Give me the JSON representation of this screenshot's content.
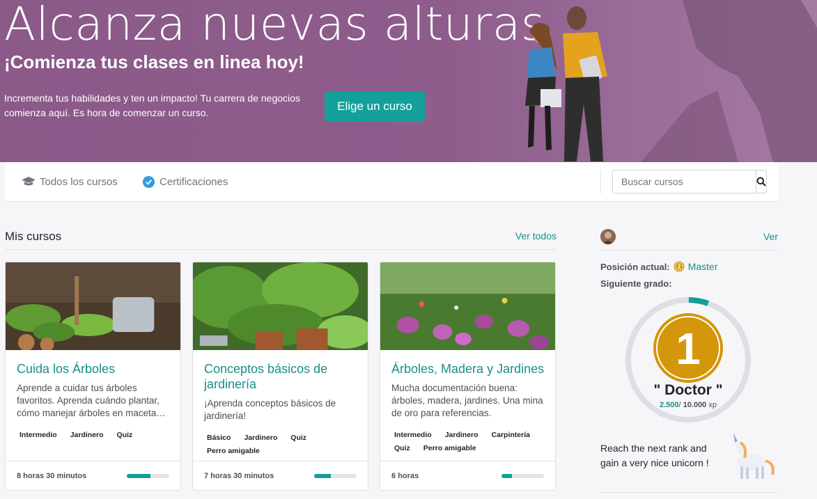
{
  "hero": {
    "title": "Alcanza nuevas alturas",
    "subtitle": "¡Comienza tus clases en linea hoy!",
    "text": "Incrementa tus habilidades y ten un impacto! Tu carrera de negocios comienza aquí. Es hora de comenzar un curso.",
    "button": "Elige un curso"
  },
  "nav": {
    "all_courses": "Todos los cursos",
    "certifications": "Certificaciones",
    "search_placeholder": "Buscar cursos"
  },
  "my_courses": {
    "title": "Mis cursos",
    "see_all": "Ver todos",
    "cards": [
      {
        "title": "Cuida los Árboles",
        "description": "Aprende a cuidar tus árboles favoritos. Aprenda cuándo plantar, cómo manejar árboles en maceta…",
        "tags": [
          "Intermedio",
          "Jardinero",
          "Quiz"
        ],
        "duration": "8 horas 30 minutos",
        "progress": 0.55
      },
      {
        "title": "Conceptos básicos de jardinería",
        "description": "¡Aprenda conceptos básicos de jardinería!",
        "tags": [
          "Básico",
          "Jardinero",
          "Quiz",
          "Perro amigable"
        ],
        "duration": "7 horas 30 minutos",
        "progress": 0.4
      },
      {
        "title": "Árboles, Madera y Jardines",
        "description": "Mucha documentación buena: árboles, madera, jardines. Una mina de oro para referencias.",
        "tags": [
          "Intermedio",
          "Jardinero",
          "Carpintería",
          "Quiz",
          "Perro amigable"
        ],
        "duration": "6 horas",
        "progress": 0.25
      }
    ]
  },
  "profile": {
    "see": "Ver",
    "current_label": "Posición actual:",
    "current_rank_number": "2",
    "current_rank": "Master",
    "next_label": "Siguiente grado:",
    "next_rank_number": "1",
    "next_rank": "\" Doctor \"",
    "xp_current": "2.500",
    "xp_sep": "/ ",
    "xp_total": "10.000",
    "xp_unit": " xp",
    "xp_fraction": 0.25,
    "reach_text": "Reach the next rank and gain a very nice unicorn !"
  },
  "colors": {
    "accent": "#14a09a",
    "link": "#168f8a",
    "hero_bg": "#8b5a89",
    "gold": "#d4960a"
  }
}
